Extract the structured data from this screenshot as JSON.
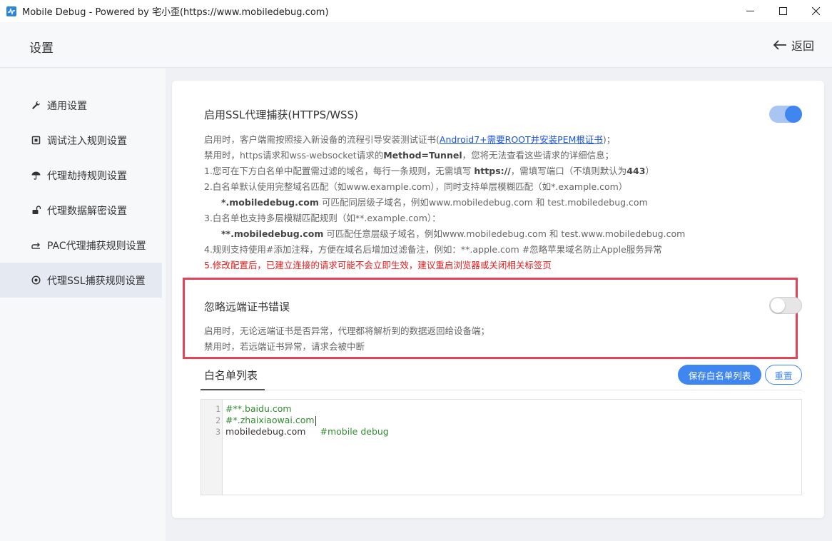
{
  "window": {
    "title": "Mobile Debug - Powered by 宅小歪(https://www.mobiledebug.com)"
  },
  "header": {
    "title": "设置",
    "back_label": "返回"
  },
  "sidebar": {
    "items": [
      {
        "label": "通用设置",
        "icon": "wrench-icon"
      },
      {
        "label": "调试注入规则设置",
        "icon": "inject-icon"
      },
      {
        "label": "代理劫持规则设置",
        "icon": "umbrella-icon"
      },
      {
        "label": "代理数据解密设置",
        "icon": "unlock-icon"
      },
      {
        "label": "PAC代理捕获规则设置",
        "icon": "route-icon"
      },
      {
        "label": "代理SSL捕获规则设置",
        "icon": "target-icon",
        "active": true
      }
    ]
  },
  "ssl": {
    "title": "启用SSL代理捕获(HTTPS/WSS)",
    "enabled": true,
    "desc1_pre": "启用时，客户端需按照接入新设备的流程引导安装测试证书(",
    "desc1_link": "Android7+需要ROOT并安装PEM根证书",
    "desc1_post": ")；",
    "desc2_pre": "禁用时，https请求和wss-websocket请求的",
    "desc2_bold": "Method=Tunnel",
    "desc2_post": "，您将无法查看这些请求的详细信息；",
    "desc3_pre": "1.您可在下方白名单中配置需过滤的域名，每行一条规则，无需填写 ",
    "desc3_bold1": "https://",
    "desc3_mid": "，需填写端口（不填则默认为",
    "desc3_bold2": "443",
    "desc3_post": "）",
    "desc4": "2.白名单默认使用完整域名匹配（如www.example.com），同时支持单层模糊匹配（如*.example.com）",
    "desc5_bold": "*.mobiledebug.com",
    "desc5_post": " 可匹配同层级子域名，例如www.mobiledebug.com 和 test.mobiledebug.com",
    "desc6": "3.白名单也支持多层模糊匹配规则（如**.example.com）：",
    "desc7_bold": "**.mobiledebug.com",
    "desc7_post": " 可匹配任意层级子域名，例如www.mobiledebug.com 和 test.www.mobiledebug.com",
    "desc8": "4.规则支持使用#添加注释，方便在域名后增加过滤备注，例如：**.apple.com    #忽略苹果域名防止Apple服务异常",
    "desc9": "5.修改配置后，已建立连接的请求可能不会立即生效，建议重启浏览器或关闭相关标签页"
  },
  "ignore_cert": {
    "title": "忽略远端证书错误",
    "enabled": false,
    "desc1": "启用时，无论远端证书是否异常，代理都将解析到的数据返回给设备端；",
    "desc2": "禁用时，若远端证书异常，请求会被中断"
  },
  "whitelist": {
    "tab_label": "白名单列表",
    "save_label": "保存白名单列表",
    "reset_label": "重置",
    "lines": [
      {
        "num": "1",
        "code": "",
        "comment": "#**.baidu.com"
      },
      {
        "num": "2",
        "code": "",
        "comment": "#*.zhaixiaowai.com"
      },
      {
        "num": "3",
        "code": "mobiledebug.com",
        "comment": "#mobile debug"
      }
    ]
  },
  "colors": {
    "accent": "#3f86f0",
    "highlight_border": "#e54358",
    "warning_text": "#e01b1b",
    "comment": "#2e8b2e"
  }
}
